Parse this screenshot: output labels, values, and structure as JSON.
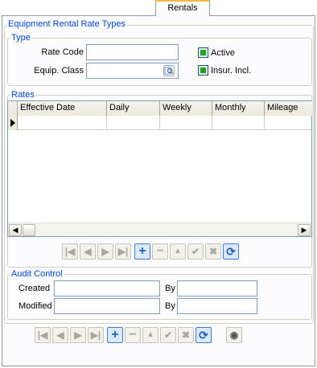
{
  "tab": {
    "label": "Rentals"
  },
  "form": {
    "title": "Equipment Rental Rate Types"
  },
  "type_group": {
    "legend": "Type",
    "rate_code_label": "Rate Code",
    "rate_code_value": "",
    "equip_class_label": "Equip. Class",
    "equip_class_value": "",
    "active_label": "Active",
    "active_checked": true,
    "insur_label": "Insur. Incl.",
    "insur_checked": true
  },
  "rates_group": {
    "legend": "Rates",
    "columns": [
      "Effective Date",
      "Daily",
      "Weekly",
      "Monthly",
      "Mileage"
    ],
    "rows": [
      [
        "",
        "",
        "",
        "",
        ""
      ]
    ]
  },
  "nav_icons": {
    "first": "|◀",
    "prev": "◀",
    "next": "▶",
    "last": "▶|",
    "add": "+",
    "delete": "−",
    "up": "▲",
    "confirm": "✔",
    "cancel": "✖",
    "refresh": "⟳",
    "view": "◉"
  },
  "audit_group": {
    "legend": "Audit Control",
    "created_label": "Created",
    "created_value": "",
    "created_by_label": "By",
    "created_by_value": "",
    "modified_label": "Modified",
    "modified_value": "",
    "modified_by_label": "By",
    "modified_by_value": ""
  }
}
